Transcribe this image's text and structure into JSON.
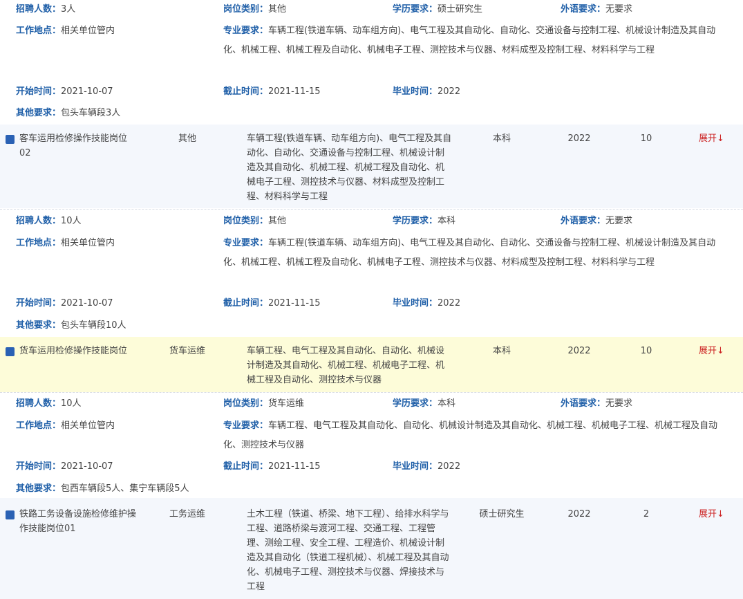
{
  "labels": {
    "count": "招聘人数：",
    "category": "岗位类别：",
    "education": "学历要求：",
    "language": "外语要求：",
    "location": "工作地点：",
    "major": "专业要求：",
    "start": "开始时间：",
    "end": "截止时间：",
    "grad": "毕业时间：",
    "other": "其他要求："
  },
  "expand_label": "展开↓",
  "details": [
    {
      "count": "3人",
      "category": "其他",
      "education": "硕士研究生",
      "language": "无要求",
      "location": "相关单位管内",
      "major": "车辆工程(铁道车辆、动车组方向)、电气工程及其自动化、自动化、交通设备与控制工程、机械设计制造及其自动化、机械工程、机械工程及自动化、机械电子工程、测控技术与仪器、材料成型及控制工程、材料科学与工程",
      "start": "2021-10-07",
      "end": "2021-11-15",
      "grad": "2022",
      "other": "包头车辆段3人"
    },
    {
      "count": "10人",
      "category": "其他",
      "education": "本科",
      "language": "无要求",
      "location": "相关单位管内",
      "major": "车辆工程(铁道车辆、动车组方向)、电气工程及其自动化、自动化、交通设备与控制工程、机械设计制造及其自动化、机械工程、机械工程及自动化、机械电子工程、测控技术与仪器、材料成型及控制工程、材料科学与工程",
      "start": "2021-10-07",
      "end": "2021-11-15",
      "grad": "2022",
      "other": "包头车辆段10人"
    },
    {
      "count": "10人",
      "category": "货车运维",
      "education": "本科",
      "language": "无要求",
      "location": "相关单位管内",
      "major": "车辆工程、电气工程及其自动化、自动化、机械设计制造及其自动化、机械工程、机械电子工程、机械工程及自动化、测控技术与仪器",
      "start": "2021-10-07",
      "end": "2021-11-15",
      "grad": "2022",
      "other": "包西车辆段5人、集宁车辆段5人"
    }
  ],
  "rows": [
    {
      "name": "客车运用检修操作技能岗位02",
      "category": "其他",
      "major": "车辆工程(铁道车辆、动车组方向)、电气工程及其自动化、自动化、交通设备与控制工程、机械设计制造及其自动化、机械工程、机械工程及自动化、机械电子工程、测控技术与仪器、材料成型及控制工程、材料科学与工程",
      "education": "本科",
      "year": "2022",
      "count": "10"
    },
    {
      "name": "货车运用检修操作技能岗位",
      "category": "货车运维",
      "major": "车辆工程、电气工程及其自动化、自动化、机械设计制造及其自动化、机械工程、机械电子工程、机械工程及自动化、测控技术与仪器",
      "education": "本科",
      "year": "2022",
      "count": "10"
    },
    {
      "name": "铁路工务设备设施检修维护操作技能岗位01",
      "category": "工务运维",
      "major": "土木工程（铁道、桥梁、地下工程）、给排水科学与工程、道路桥梁与渡河工程、交通工程、工程管理、测绘工程、安全工程、工程造价、机械设计制造及其自动化（铁道工程机械）、机械工程及其自动化、机械电子工程、测控技术与仪器、焊接技术与工程",
      "education": "硕士研究生",
      "year": "2022",
      "count": "2"
    }
  ]
}
